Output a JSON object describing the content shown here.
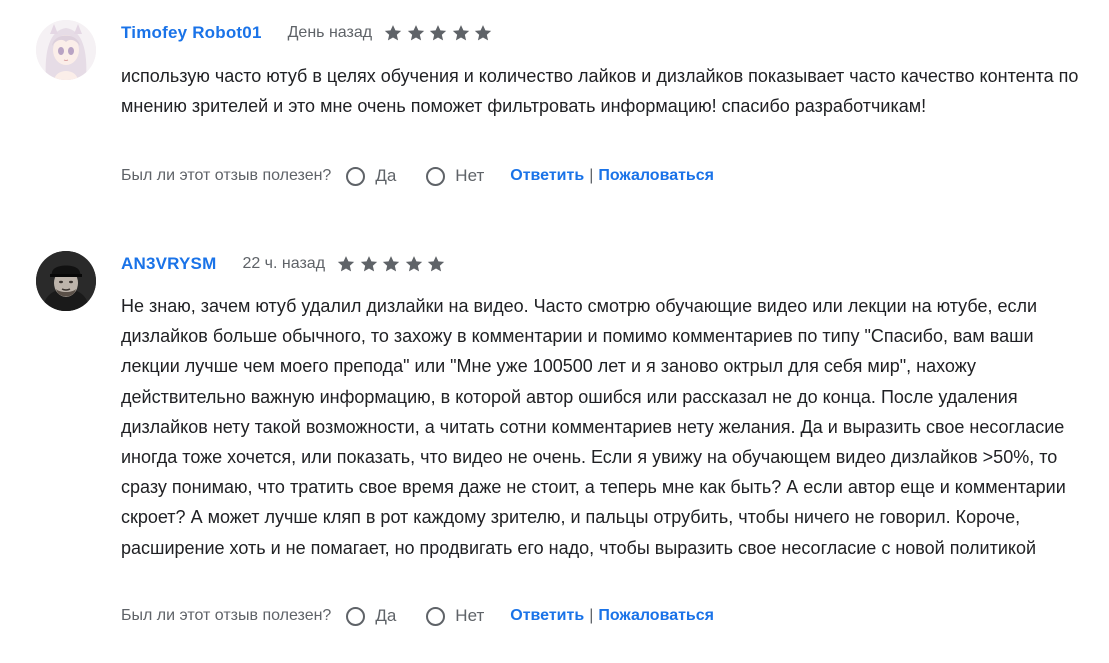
{
  "reviews": [
    {
      "author": "Timofey Robot01",
      "date": "День назад",
      "rating": 5,
      "avatar": "anime-girl-avatar",
      "text": "использую часто ютуб в целях обучения и количество лайков и дизлайков показывает часто качество контента по мнению зрителей и это мне очень поможет фильтровать информацию! спасибо разработчикам!",
      "helpful_question": "Был ли этот отзыв полезен?",
      "yes_label": "Да",
      "no_label": "Нет",
      "reply_label": "Ответить",
      "separator": "|",
      "report_label": "Пожаловаться"
    },
    {
      "author": "AN3VRYSM",
      "date": "22 ч. назад",
      "rating": 5,
      "avatar": "man-in-cap-avatar",
      "text": "Не знаю, зачем ютуб удалил дизлайки на видео. Часто смотрю обучающие видео или лекции на ютубе, если дизлайков больше обычного, то захожу в комментарии и помимо комментариев по типу \"Спасибо, вам ваши лекции лучше чем моего препода\" или \"Мне уже 100500 лет и я заново октрыл для себя мир\", нахожу действительно важную информацию, в которой автор ошибся или рассказал не до конца. После удаления дизлайков нету такой возможности, а читать сотни комментариев нету желания. Да и выразить свое несогласие иногда тоже хочется, или показать, что видео не очень. Если я увижу на обучающем видео дизлайков >50%, то сразу понимаю, что тратить свое время даже не стоит, а теперь мне как быть? А если автор еще и комментарии скроет? А может лучше кляп в рот каждому зрителю, и пальцы отрубить, чтобы ничего не говорил. Короче, расширение хоть и не помагает, но продвигать его надо, чтобы выразить свое несогласие с новой политикой",
      "helpful_question": "Был ли этот отзыв полезен?",
      "yes_label": "Да",
      "no_label": "Нет",
      "reply_label": "Ответить",
      "separator": "|",
      "report_label": "Пожаловаться"
    }
  ],
  "colors": {
    "link": "#1a73e8",
    "text": "#202124",
    "secondary": "#5f6368",
    "star": "#5f6368"
  }
}
